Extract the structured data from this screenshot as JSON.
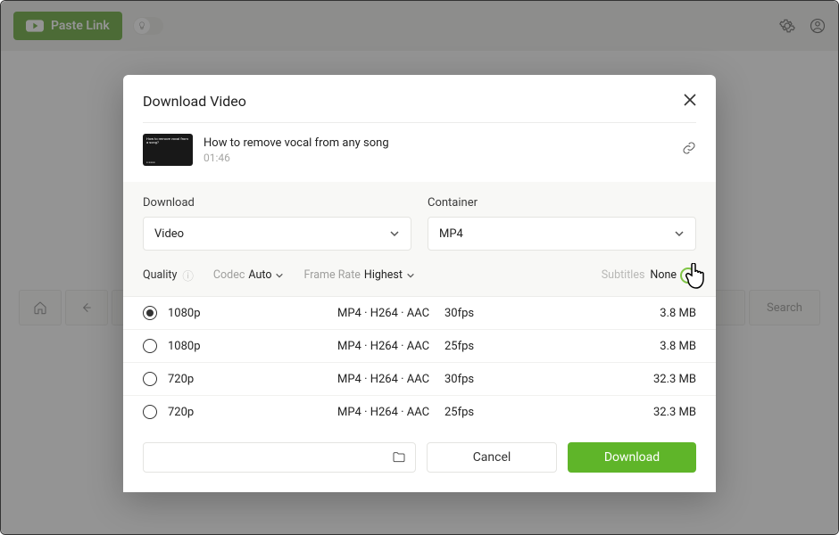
{
  "topbar": {
    "paste_label": "Paste Link",
    "search_placeholder": "Search"
  },
  "modal": {
    "title": "Download Video",
    "video": {
      "thumb_text": "How to remove vocal from a song?",
      "title": "How to remove vocal from any song",
      "duration": "01:46"
    },
    "selects": {
      "download_label": "Download",
      "download_value": "Video",
      "container_label": "Container",
      "container_value": "MP4"
    },
    "meta": {
      "quality_label": "Quality",
      "codec_label": "Codec",
      "codec_value": "Auto",
      "framerate_label": "Frame Rate",
      "framerate_value": "Highest",
      "subtitles_label": "Subtitles",
      "subtitles_value": "None"
    },
    "quality_rows": [
      {
        "res": "1080p",
        "fmt": "MP4 · H264 · AAC",
        "fps": "30fps",
        "size": "3.8 MB",
        "selected": true
      },
      {
        "res": "1080p",
        "fmt": "MP4 · H264 · AAC",
        "fps": "25fps",
        "size": "3.8 MB",
        "selected": false
      },
      {
        "res": "720p",
        "fmt": "MP4 · H264 · AAC",
        "fps": "30fps",
        "size": "32.3 MB",
        "selected": false
      },
      {
        "res": "720p",
        "fmt": "MP4 · H264 · AAC",
        "fps": "25fps",
        "size": "32.3 MB",
        "selected": false
      }
    ],
    "cancel_label": "Cancel",
    "download_label": "Download"
  }
}
